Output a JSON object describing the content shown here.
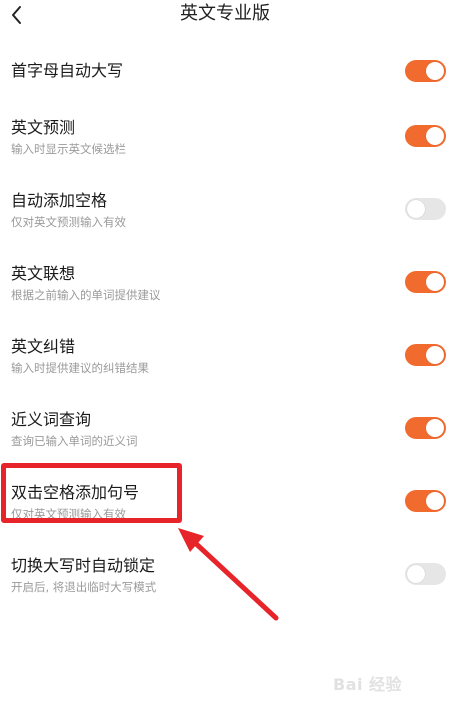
{
  "header": {
    "title": "英文专业版"
  },
  "settings": [
    {
      "title": "首字母自动大写",
      "subtitle": "",
      "enabled": true
    },
    {
      "title": "英文预测",
      "subtitle": "输入时显示英文候选栏",
      "enabled": true
    },
    {
      "title": "自动添加空格",
      "subtitle": "仅对英文预测输入有效",
      "enabled": false
    },
    {
      "title": "英文联想",
      "subtitle": "根据之前输入的单词提供建议",
      "enabled": true
    },
    {
      "title": "英文纠错",
      "subtitle": "输入时提供建议的纠错结果",
      "enabled": true
    },
    {
      "title": "近义词查询",
      "subtitle": "查询已输入单词的近义词",
      "enabled": true
    },
    {
      "title": "双击空格添加句号",
      "subtitle": "仅对英文预测输入有效",
      "enabled": true
    },
    {
      "title": "切换大写时自动锁定",
      "subtitle": "开启后, 将退出临时大写模式",
      "enabled": false
    }
  ],
  "colors": {
    "accent": "#f26b2e",
    "toggle_off": "#e6e6e6",
    "annotation": "#e8242b"
  },
  "watermark": {
    "text": "Bai 经验"
  }
}
